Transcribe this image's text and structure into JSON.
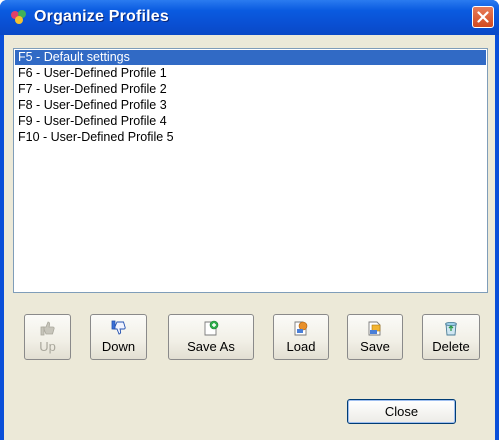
{
  "window": {
    "title": "Organize Profiles"
  },
  "profiles": [
    {
      "label": "F5 - Default settings",
      "selected": true
    },
    {
      "label": "F6 - User-Defined Profile 1",
      "selected": false
    },
    {
      "label": "F7 - User-Defined Profile 2",
      "selected": false
    },
    {
      "label": "F8 - User-Defined Profile 3",
      "selected": false
    },
    {
      "label": "F9 - User-Defined Profile 4",
      "selected": false
    },
    {
      "label": "F10 - User-Defined Profile 5",
      "selected": false
    }
  ],
  "toolbar": {
    "up_label": "Up",
    "down_label": "Down",
    "save_as_label": "Save As",
    "load_label": "Load",
    "save_label": "Save",
    "delete_label": "Delete"
  },
  "footer": {
    "close_label": "Close"
  },
  "colors": {
    "titlebar": "#0a4fd9",
    "selection": "#316ac5",
    "dialog_bg": "#ece9d8"
  }
}
